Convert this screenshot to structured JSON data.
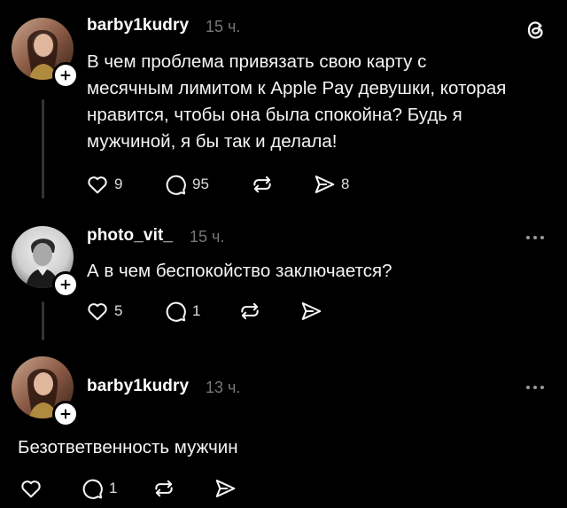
{
  "posts": [
    {
      "username": "barby1kudry",
      "time": "15 ч.",
      "text_lines": [
        "В чем проблема привязать свою карту с",
        "месячным лимитом к Apple Pay девушки, которая",
        "нравится, чтобы она была спокойна? Будь я",
        "мужчиной, я бы так и делала!"
      ],
      "likes": "9",
      "replies": "95",
      "shares": "8"
    },
    {
      "username": "photo_vit_",
      "time": "15 ч.",
      "text_lines": [
        "А в чем беспокойство заключается?"
      ],
      "likes": "5",
      "replies": "1"
    },
    {
      "username": "barby1kudry",
      "time": "13 ч.",
      "text_lines": [
        "Безответвенность мужчин"
      ],
      "replies": "1"
    }
  ],
  "icons": {
    "app_logo": "threads-logo-icon",
    "like": "heart-icon",
    "reply": "comment-icon",
    "repost": "repost-icon",
    "share": "send-icon",
    "follow": "plus-icon",
    "more": "more-options-icon"
  },
  "colors": {
    "background": "#000000",
    "text": "#f3f5f7",
    "muted": "#777777",
    "thread_line": "#333333"
  }
}
